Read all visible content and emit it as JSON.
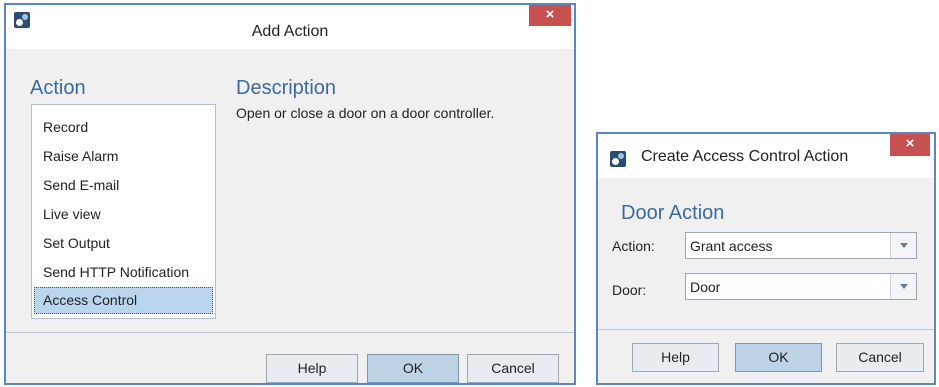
{
  "add_action": {
    "title": "Add Action",
    "close_glyph": "×",
    "action_heading": "Action",
    "description_heading": "Description",
    "description_text": "Open or close a door on a door controller.",
    "actions": [
      {
        "label": "Record"
      },
      {
        "label": "Raise Alarm"
      },
      {
        "label": "Send E-mail"
      },
      {
        "label": "Live view"
      },
      {
        "label": "Set Output"
      },
      {
        "label": "Send HTTP Notification"
      },
      {
        "label": "Access Control",
        "selected": true
      }
    ],
    "buttons": {
      "help": "Help",
      "ok": "OK",
      "cancel": "Cancel"
    }
  },
  "access_control": {
    "title": "Create Access Control Action",
    "close_glyph": "×",
    "heading": "Door Action",
    "action_label": "Action:",
    "action_value": "Grant access",
    "door_label": "Door:",
    "door_value": "Door",
    "buttons": {
      "help": "Help",
      "ok": "OK",
      "cancel": "Cancel"
    }
  },
  "colors": {
    "accent_heading": "#3c6aa0",
    "window_border": "#5a87c3",
    "close_button": "#c75050",
    "selection": "#bad6ee"
  },
  "icons": {
    "app": "app-icon",
    "close": "close-icon",
    "dropdown": "chevron-down-icon"
  }
}
